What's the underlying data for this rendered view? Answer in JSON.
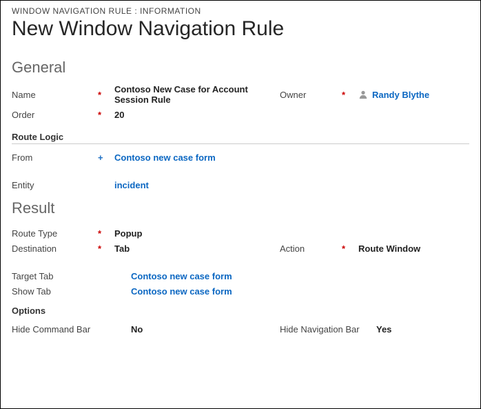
{
  "breadcrumb": "WINDOW NAVIGATION RULE : INFORMATION",
  "page_title": "New Window Navigation Rule",
  "sections": {
    "general": {
      "heading": "General",
      "name_label": "Name",
      "name_value": "Contoso New Case for Account Session Rule",
      "owner_label": "Owner",
      "owner_value": "Randy Blythe",
      "order_label": "Order",
      "order_value": "20",
      "route_logic_heading": "Route Logic",
      "from_label": "From",
      "from_value": "Contoso new case form",
      "entity_label": "Entity",
      "entity_value": "incident"
    },
    "result": {
      "heading": "Result",
      "route_type_label": "Route Type",
      "route_type_value": "Popup",
      "destination_label": "Destination",
      "destination_value": "Tab",
      "action_label": "Action",
      "action_value": "Route Window",
      "target_tab_label": "Target Tab",
      "target_tab_value": "Contoso new case form",
      "show_tab_label": "Show Tab",
      "show_tab_value": "Contoso new case form",
      "options_heading": "Options",
      "hide_cmd_label": "Hide Command Bar",
      "hide_cmd_value": "No",
      "hide_nav_label": "Hide Navigation Bar",
      "hide_nav_value": "Yes"
    }
  },
  "marks": {
    "required": "*",
    "recommended": "+"
  }
}
